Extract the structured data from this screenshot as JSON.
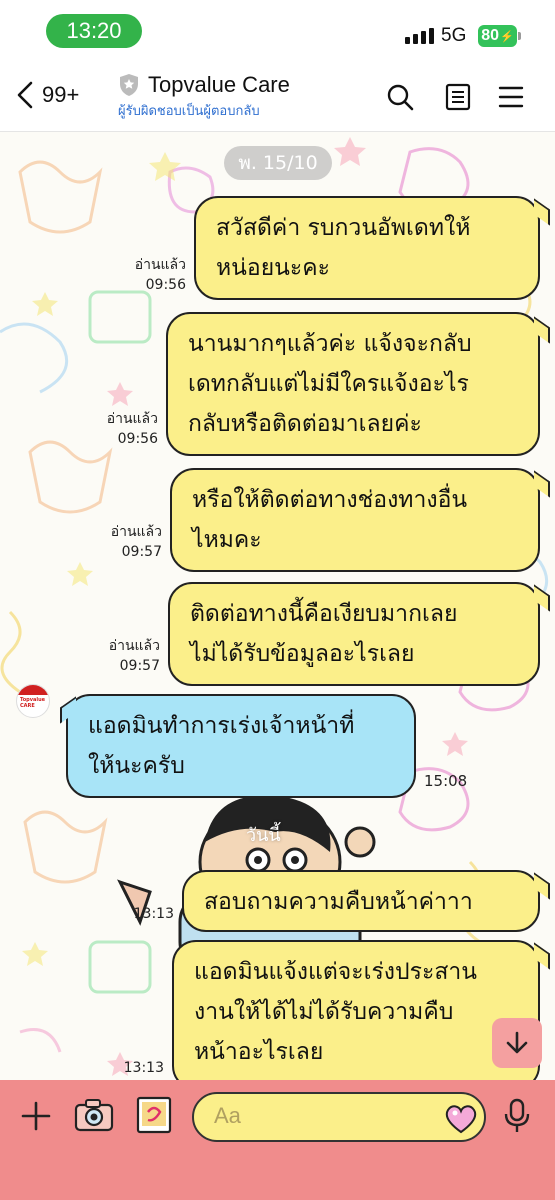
{
  "status_bar": {
    "time": "13:20",
    "network": "5G",
    "battery": "80"
  },
  "header": {
    "back_count": "99+",
    "title": "Topvalue Care",
    "subtitle": "ผู้รับผิดชอบเป็นผู้ตอบกลับ"
  },
  "chat": {
    "date_label": "พ. 15/10",
    "today_label": "วันนี้",
    "messages": [
      {
        "text_lines": [
          "สวัสดีค่า รบกวนอัพเดทให้",
          "หน่อยนะคะ"
        ],
        "read": "อ่านแล้ว",
        "time": "09:56"
      },
      {
        "text_lines": [
          "นานมากๆแล้วค่ะ แจ้งจะกลับ",
          "เดทกลับแต่ไม่มีใครแจ้งอะไร",
          "กลับหรือติดต่อมาเลยค่ะ"
        ],
        "read": "อ่านแล้ว",
        "time": "09:56"
      },
      {
        "text_lines": [
          "หรือให้ติดต่อทางช่องทางอื่น",
          "ไหมคะ"
        ],
        "read": "อ่านแล้ว",
        "time": "09:57"
      },
      {
        "text_lines": [
          "ติดต่อทางนี้คือเงียบมากเลย",
          "ไม่ได้รับข้อมูลอะไรเลย"
        ],
        "read": "อ่านแล้ว",
        "time": "09:57"
      },
      {
        "text_lines": [
          "แอดมินทำการเร่งเจ้าหน้าที่",
          "ให้นะครับ"
        ],
        "time": "15:08"
      },
      {
        "text_lines": [
          "สอบถามความคืบหน้าค่าาา"
        ],
        "time": "13:13"
      },
      {
        "text_lines": [
          "แอดมินแจ้งแต่จะเร่งประสาน",
          "งานให้ได้ไม่ได้รับความคืบ",
          "หน้าอะไรเลย"
        ],
        "time": "13:13"
      }
    ],
    "avatar_text": "Topvalue CARE"
  },
  "input": {
    "placeholder": "Aa"
  },
  "colors": {
    "outgoing_bubble": "#fbef8a",
    "incoming_bubble": "#a8e4f7",
    "input_bar": "#f08c8c",
    "time_pill": "#33b34a",
    "battery": "#33c25a",
    "subtitle": "#2f6fd0"
  },
  "icons": [
    "back-chevron-icon",
    "shield-icon",
    "search-icon",
    "notes-icon",
    "menu-icon",
    "chevron-down-icon",
    "plus-icon",
    "camera-icon",
    "image-icon",
    "heart-emoji-icon",
    "microphone-icon"
  ]
}
